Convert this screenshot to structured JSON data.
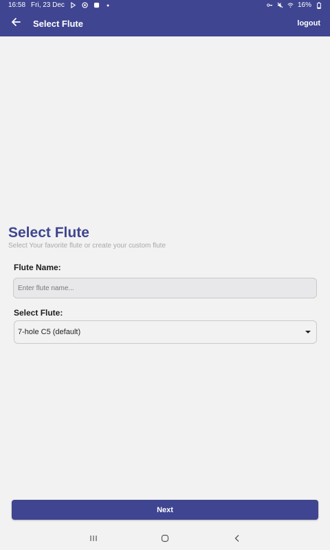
{
  "status_bar": {
    "time": "16:58",
    "date": "Fri, 23 Dec",
    "icons_left": [
      "play-store-icon",
      "shield-icon",
      "gallery-icon",
      "dot-icon"
    ],
    "icons_right": [
      "key-icon",
      "mute-icon",
      "wifi-icon",
      "battery-icon"
    ],
    "battery_percent": "16%"
  },
  "app_bar": {
    "title": "Select Flute",
    "logout_label": "logout",
    "back_icon": "arrow-left-icon",
    "background_color": "#3f4590"
  },
  "page": {
    "title": "Select Flute",
    "subtitle": "Select Your favorite flute or create your custom flute"
  },
  "form": {
    "flute_name_label": "Flute Name:",
    "flute_name_value": "",
    "flute_name_placeholder": "Enter flute name...",
    "select_flute_label": "Select Flute:",
    "select_flute_value": "7-hole C5 (default)"
  },
  "actions": {
    "next_label": "Next"
  },
  "nav_bar": {
    "icons": [
      "recents-icon",
      "home-icon",
      "back-icon"
    ]
  },
  "colors": {
    "primary": "#3f4590",
    "background": "#f2f2f2"
  }
}
